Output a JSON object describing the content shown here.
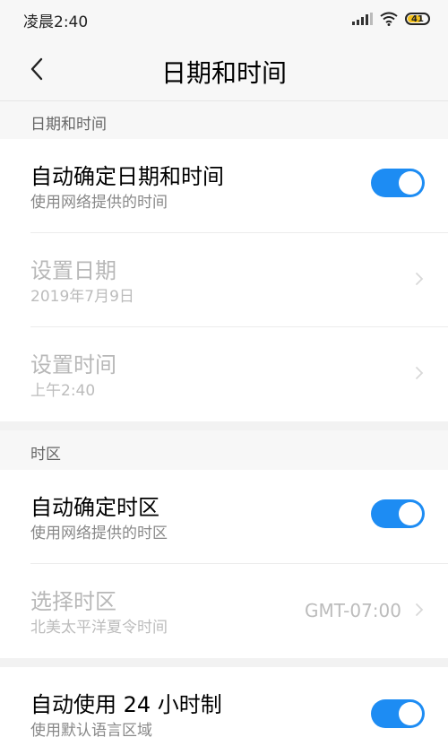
{
  "status_bar": {
    "time": "凌晨2:40",
    "battery": "41"
  },
  "header": {
    "title": "日期和时间"
  },
  "sections": {
    "date_time": {
      "label": "日期和时间",
      "auto_datetime": {
        "title": "自动确定日期和时间",
        "subtitle": "使用网络提供的时间",
        "enabled": true
      },
      "set_date": {
        "title": "设置日期",
        "subtitle": "2019年7月9日"
      },
      "set_time": {
        "title": "设置时间",
        "subtitle": "上午2:40"
      }
    },
    "timezone": {
      "label": "时区",
      "auto_timezone": {
        "title": "自动确定时区",
        "subtitle": "使用网络提供的时区",
        "enabled": true
      },
      "select_timezone": {
        "title": "选择时区",
        "subtitle": "北美太平洋夏令时间",
        "value": "GMT-07:00"
      }
    },
    "format": {
      "use_24h": {
        "title": "自动使用 24 小时制",
        "subtitle": "使用默认语言区域",
        "enabled": true
      }
    }
  },
  "colors": {
    "accent": "#1d8cf3",
    "background": "#f7f7f7",
    "disabled_text": "#b8b8b8"
  }
}
